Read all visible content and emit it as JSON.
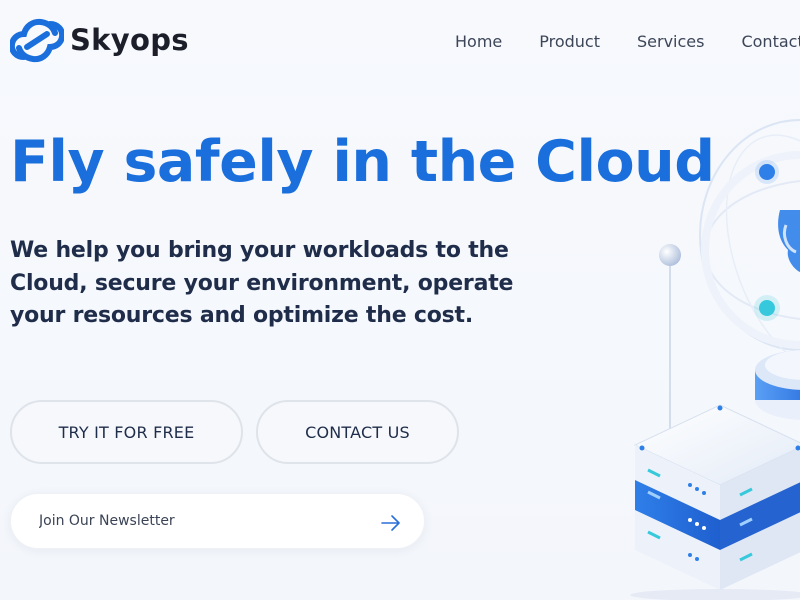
{
  "brand": {
    "name": "Skyops",
    "logo_icon": "cloud-link-icon",
    "accent": "#1a6fdc"
  },
  "nav": {
    "items": [
      {
        "label": "Home"
      },
      {
        "label": "Product"
      },
      {
        "label": "Services"
      },
      {
        "label": "Contact"
      }
    ]
  },
  "hero": {
    "title": "Fly safely in the Cloud",
    "subtitle": "We help you bring your workloads to the Cloud, secure your environment, operate your resources and optimize the cost."
  },
  "buttons": {
    "try_label": "TRY IT FOR FREE",
    "contact_label": "CONTACT US"
  },
  "newsletter": {
    "placeholder": "Join Our Newsletter",
    "submit_icon": "arrow-right-icon"
  },
  "illustration": {
    "name": "cloud-server-illustration",
    "colors": {
      "primary": "#2a7ee8",
      "accent": "#36c9dc",
      "light": "#e8effa"
    }
  }
}
